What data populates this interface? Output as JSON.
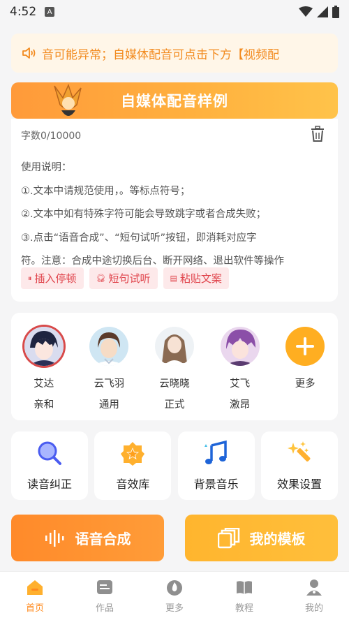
{
  "status_bar": {
    "time": "4:52",
    "app_icon_letter": "A"
  },
  "notice": {
    "icon": "speaker-icon",
    "text": "音可能异常；自媒体配音可点击下方【视频配"
  },
  "sample_banner": {
    "title": "自媒体配音样例"
  },
  "editor": {
    "word_count": "字数0/10000",
    "instructions": [
      "使用说明：",
      "①.文本中请规范使用，。等标点符号；",
      "②.文本中如有特殊字符可能会导致跳字或者合成失败；",
      "③.点击“语音合成”、“短句试听”按钮，即消耗对应字",
      "符。注意：合成中途切换后台、断开网络、退出软件等操作"
    ],
    "chips": [
      {
        "icon": "pause-icon",
        "label": "插入停顿"
      },
      {
        "icon": "headphone-icon",
        "label": "短句试听"
      },
      {
        "icon": "clipboard-icon",
        "label": "粘贴文案"
      }
    ]
  },
  "voices": [
    {
      "name": "艾达",
      "style": "亲和",
      "selected": true
    },
    {
      "name": "云飞羽",
      "style": "通用",
      "selected": false
    },
    {
      "name": "云晓晓",
      "style": "正式",
      "selected": false
    },
    {
      "name": "艾飞",
      "style": "激昂",
      "selected": false
    }
  ],
  "voices_more": {
    "label": "更多"
  },
  "tools": [
    {
      "icon": "magnifier-icon",
      "label": "读音纠正"
    },
    {
      "icon": "star-icon",
      "label": "音效库"
    },
    {
      "icon": "music-note-icon",
      "label": "背景音乐"
    },
    {
      "icon": "magic-wand-icon",
      "label": "效果设置"
    }
  ],
  "actions": {
    "synthesize": "语音合成",
    "templates": "我的模板"
  },
  "tabs": [
    {
      "icon": "home-icon",
      "label": "首页",
      "active": true
    },
    {
      "icon": "works-icon",
      "label": "作品",
      "active": false
    },
    {
      "icon": "fire-icon",
      "label": "更多",
      "active": false
    },
    {
      "icon": "book-icon",
      "label": "教程",
      "active": false
    },
    {
      "icon": "user-icon",
      "label": "我的",
      "active": false
    }
  ],
  "colors": {
    "accent": "#ff8a1e",
    "chip_text": "#e0434b",
    "chip_bg": "#fde9ea"
  }
}
